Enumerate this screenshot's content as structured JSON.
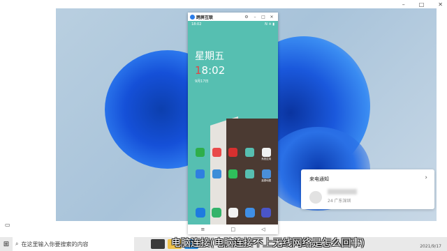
{
  "window": {
    "app_title": "跨屏互联",
    "controls": [
      "⚙",
      "–",
      "□",
      "✕"
    ],
    "outer_controls": [
      "–",
      "□",
      "✕"
    ]
  },
  "phone": {
    "status_time": "18:02",
    "status_right": "N ✈ ▮",
    "weekday": "星期五",
    "time_first": "1",
    "time_rest": "8:02",
    "date": "9月17日",
    "apps_row1": [
      {
        "label": "",
        "color": "#2fae4a"
      },
      {
        "label": "",
        "color": "#e94a4a"
      },
      {
        "label": "",
        "color": "#d7302f"
      },
      {
        "label": "",
        "color": "#57bfb1"
      },
      {
        "label": "系统应用",
        "color": "#f1f1f1"
      }
    ],
    "apps_row2": [
      {
        "label": "",
        "color": "#2f7fe0"
      },
      {
        "label": "",
        "color": "#3d8ed8"
      },
      {
        "label": "",
        "color": "#2fbe5b"
      },
      {
        "label": "",
        "color": "#57bfb1"
      },
      {
        "label": "高德地图",
        "color": "#4a8fd9"
      }
    ],
    "dock": [
      {
        "color": "#1e7be0"
      },
      {
        "color": "#33b36a"
      },
      {
        "color": "#f2f2f2"
      },
      {
        "color": "#3f8fe6"
      },
      {
        "color": "#4a55c8"
      }
    ],
    "nav": [
      "≡",
      "□",
      "◁"
    ]
  },
  "notification": {
    "title": "来电通知",
    "chevron": "›",
    "location": "24 广东深圳"
  },
  "taskbar": {
    "start_icon": "windows-logo",
    "search_placeholder": "在这里输入你要搜索的内容",
    "icons": [
      {
        "name": "task-view",
        "color": "#3a3a3a"
      },
      {
        "name": "explorer",
        "color": "#f0c24a"
      },
      {
        "name": "edge",
        "color": "#2a8be0"
      }
    ],
    "clock": "2021/9/17"
  },
  "caption": "电脑连接(电脑连接不上无线网络是怎么回事)"
}
